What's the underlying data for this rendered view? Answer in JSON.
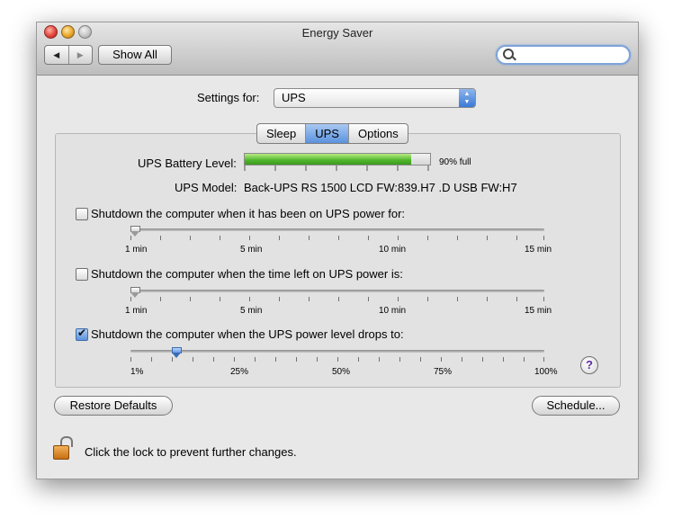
{
  "window": {
    "title": "Energy Saver"
  },
  "toolbar": {
    "back": "◀",
    "forward": "▶",
    "show_all": "Show All",
    "search_placeholder": ""
  },
  "settings": {
    "label": "Settings for:",
    "value": "UPS"
  },
  "tabs": [
    "Sleep",
    "UPS",
    "Options"
  ],
  "active_tab": "UPS",
  "ups": {
    "battery_label": "UPS Battery Level:",
    "battery_level": 0.9,
    "battery_text": "90% full",
    "battery_color": "#4eb52b",
    "model_label": "UPS Model:",
    "model_value": "Back-UPS RS 1500 LCD FW:839.H7 .D USB FW:H7"
  },
  "options": [
    {
      "label": "Shutdown the computer when it has been on UPS power for:",
      "checked": false,
      "ticks": [
        "1 min",
        "5 min",
        "10 min",
        "15 min"
      ],
      "value_fraction": 0.0
    },
    {
      "label": "Shutdown the computer when the time left on UPS power is:",
      "checked": false,
      "ticks": [
        "1 min",
        "5 min",
        "10 min",
        "15 min"
      ],
      "value_fraction": 0.0
    },
    {
      "label": "Shutdown the computer when the UPS power level drops to:",
      "checked": true,
      "ticks": [
        "1%",
        "25%",
        "50%",
        "75%",
        "100%"
      ],
      "value_fraction": 0.11
    }
  ],
  "buttons": {
    "restore": "Restore Defaults",
    "schedule": "Schedule..."
  },
  "lock_text": "Click the lock to prevent further changes.",
  "help_glyph": "?"
}
